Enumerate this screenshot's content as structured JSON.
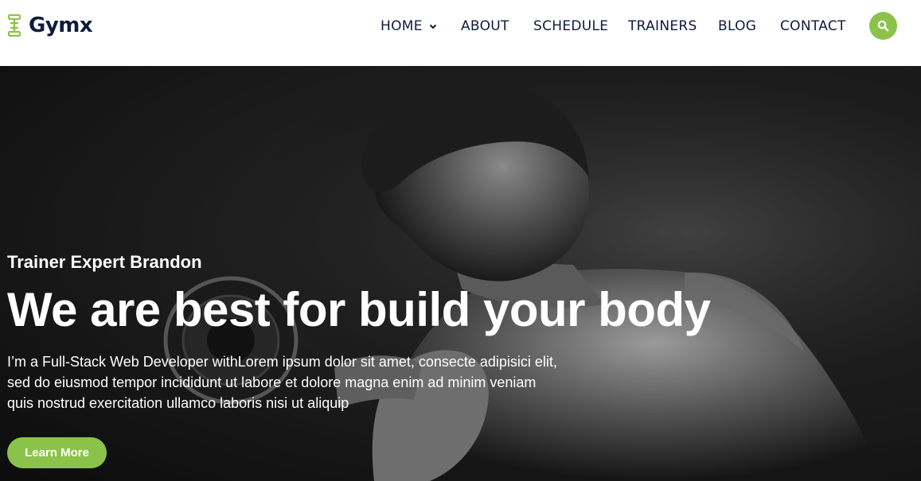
{
  "brand": {
    "name": "Gymx",
    "logo_icon": "dumbbell-icon",
    "accent": "#8bc34a",
    "text_color": "#0f1b3d"
  },
  "nav": {
    "items": [
      {
        "label": "HOME",
        "has_dropdown": true
      },
      {
        "label": "ABOUT"
      },
      {
        "label": "SCHEDULE"
      },
      {
        "label": "TRAINERS"
      },
      {
        "label": "BLOG"
      },
      {
        "label": "CONTACT"
      }
    ],
    "search_icon": "search-icon"
  },
  "hero": {
    "subtitle": "Trainer Expert Brandon",
    "title": "We are best for build your body",
    "description_lines": [
      "I’m a Full-Stack Web Developer withLorem ipsum dolor sit amet, consecte adipisici elit,",
      "sed do eiusmod tempor incididunt ut labore et dolore magna enim ad minim veniam",
      "quis nostrud exercitation ullamco laboris nisi ut aliquip"
    ],
    "cta_label": "Learn More"
  }
}
